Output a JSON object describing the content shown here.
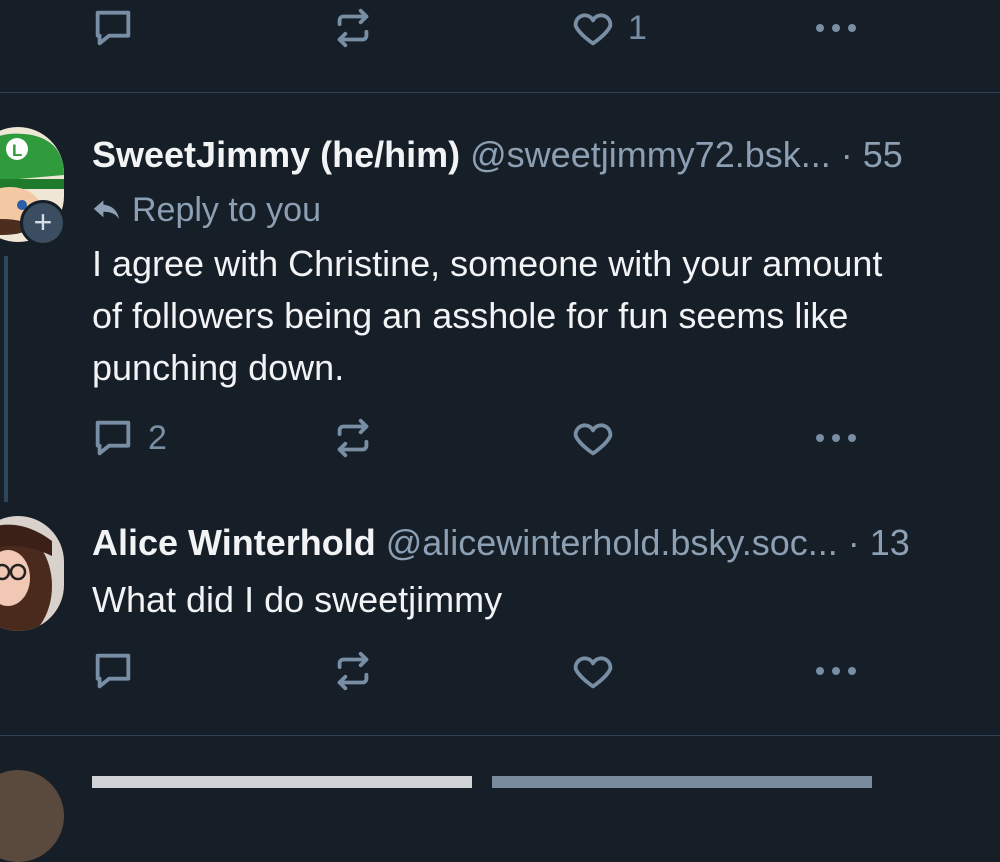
{
  "top_post": {
    "like_count": "1"
  },
  "post1": {
    "author_name": "SweetJimmy (he/him)",
    "handle": "@sweetjimmy72.bsk...",
    "time": "· 55",
    "reply_label": "Reply to you",
    "text_lines": [
      "I agree with Christine, someone with your amount",
      "of followers being an asshole for fun seems like",
      "punching down."
    ],
    "reply_count": "2",
    "follow_badge": "+"
  },
  "post2": {
    "author_name": "Alice Winterhold",
    "handle": "@alicewinterhold.bsky.soc...",
    "time": "· 13",
    "text": "What did I do sweetjimmy"
  },
  "colors": {
    "background": "#161e27",
    "text": "#f1f3f5",
    "muted": "#8c9fb3",
    "icon": "#788ea5",
    "divider": "#2e4052"
  }
}
